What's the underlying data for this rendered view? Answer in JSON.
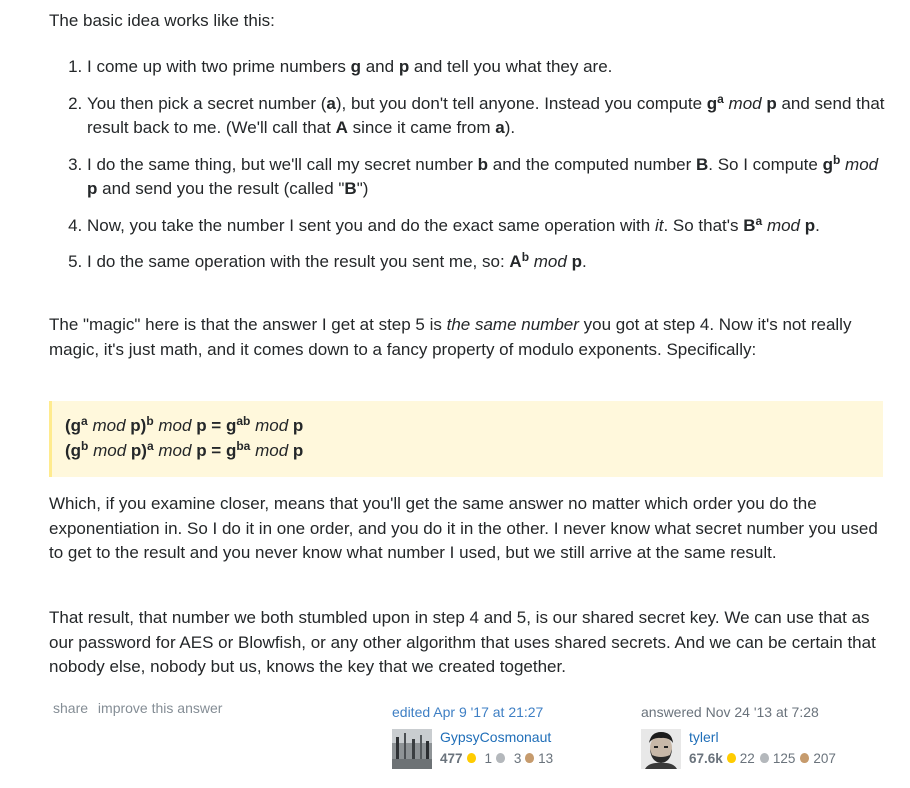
{
  "intro": "The basic idea works like this:",
  "steps": {
    "s1": {
      "t1": "I come up with two prime numbers ",
      "g": "g",
      "t2": " and ",
      "p": "p",
      "t3": " and tell you what they are."
    },
    "s2": {
      "t1": "You then pick a secret number (",
      "a": "a",
      "t2": "), but you don't tell anyone. Instead you compute ",
      "g": "g",
      "sup": "a",
      "mod": " mod ",
      "p": "p",
      "t3": " and send that result back to me. (We'll call that ",
      "A": "A",
      "t4": " since it came from ",
      "a2": "a",
      "t5": ")."
    },
    "s3": {
      "t1": "I do the same thing, but we'll call my secret number ",
      "b": "b",
      "t2": " and the computed number ",
      "B": "B",
      "t3": ". So I compute ",
      "g": "g",
      "sup": "b",
      "mod": " mod ",
      "p": "p",
      "t4": " and send you the result (called \"",
      "B2": "B",
      "t5": "\")"
    },
    "s4": {
      "t1": "Now, you take the number I sent you and do the exact same operation with ",
      "it": "it",
      "t2": ". So that's ",
      "B": "B",
      "sup": "a",
      "mod": " mod ",
      "p": "p",
      "t3": "."
    },
    "s5": {
      "t1": "I do the same operation with the result you sent me, so: ",
      "A": "A",
      "sup": "b",
      "mod": " mod ",
      "p": "p",
      "t2": "."
    }
  },
  "magic": {
    "t1": "The \"magic\" here is that the answer I get at step 5 is ",
    "em": "the same number",
    "t2": " you got at step 4. Now it's not really magic, it's just math, and it comes down to a fancy property of modulo exponents. Specifically:"
  },
  "formula": {
    "l1": {
      "open": "(g",
      "sup1": "a",
      "mod1": " mod ",
      "mid": "p)",
      "sup2": "b",
      "mod2": " mod ",
      "rhs": "p = g",
      "sup3": "ab",
      "mod3": " mod ",
      "end": "p"
    },
    "l2": {
      "open": "(g",
      "sup1": "b",
      "mod1": " mod ",
      "mid": "p)",
      "sup2": "a",
      "mod2": " mod ",
      "rhs": "p = g",
      "sup3": "ba",
      "mod3": " mod ",
      "end": "p"
    }
  },
  "which": "Which, if you examine closer, means that you'll get the same answer no matter which order you do the exponentiation in. So I do it in one order, and you do it in the other. I never know what secret number you used to get to the result and you never know what number I used, but we still arrive at the same result.",
  "result": "That result, that number we both stumbled upon in step 4 and 5, is our shared secret key. We can use that as our password for AES or Blowfish, or any other algorithm that uses shared secrets. And we can be certain that nobody else, nobody but us, knows the key that we created together.",
  "menu": {
    "share": "share",
    "improve": "improve this answer"
  },
  "editor": {
    "action": "edited Apr 9 '17 at 21:27",
    "name": "GypsyCosmonaut",
    "rep": "477",
    "gold": "",
    "silver": "1",
    "bronze": "3",
    "bronze_count": "13"
  },
  "owner": {
    "action": "answered Nov 24 '13 at 7:28",
    "name": "tylerl",
    "rep": "67.6k",
    "gold": "22",
    "silver": "125",
    "bronze": "207"
  },
  "colors": {
    "link": "#1f6eb8",
    "quote_bg": "#fff8dc",
    "quote_border": "#ffeb8e",
    "gold": "#ffcc01",
    "silver": "#b4b8bc",
    "bronze": "#c69b6d"
  }
}
